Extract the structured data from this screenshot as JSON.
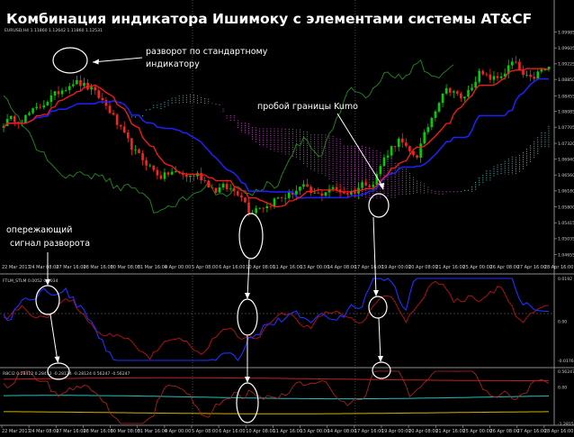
{
  "title": "Комбинация индикатора Ишимоку с элементами системы AT&CF",
  "symbol_label": "EURUSD,H4  1.11860 1.12642 1.11860 1.12531",
  "panel2_label": "FTLM_STLM 0.0052 0.0034",
  "panel3_label": "RBCI2 0.28412 0.28412 -0.28124 -0.28124 0.56247 -0.56247",
  "annotations": {
    "reversal_standard": [
      "разворот по стандартному",
      "индикатору"
    ],
    "kumo_breakout": "пробой границы Kumo",
    "leading_signal": [
      "опережающий",
      "сигнал разворота"
    ]
  },
  "colors": {
    "background": "#000000",
    "bull_candle": "#00d000",
    "bear_candle": "#ff2020",
    "tenkan": "#ff1a1a",
    "kijun": "#2020ff",
    "chikou": "#1e8c1e",
    "kumo_bull": "#4dd0c8",
    "kumo_bear": "#d84cd8",
    "ftlm": "#2030ff",
    "stlm": "#c01010",
    "rbci_cyan": "#20c0c0",
    "rbci_yellow": "#d4b000",
    "rbci_red": "#c02020",
    "grid": "#5a5a5a"
  },
  "chart_data": [
    {
      "type": "candlestick",
      "symbol": "EURUSD",
      "timeframe": "H4",
      "y_ticks": [
        "1.09985",
        "1.09605",
        "1.09225",
        "1.08850",
        "1.08455",
        "1.08085",
        "1.07705",
        "1.07320",
        "1.06940",
        "1.06560",
        "1.06180",
        "1.05800",
        "1.05415",
        "1.05035",
        "1.04655"
      ],
      "ylim": [
        1.0445,
        1.1002
      ],
      "x_ticks": [
        "22 Mar 2017",
        "24 Mar 08:00",
        "27 Mar 16:00",
        "28 Mar 16:00",
        "30 Mar 08:00",
        "31 Mar 16:00",
        "4 Apr 00:00",
        "5 Apr 08:00",
        "6 Apr 16:00",
        "10 Apr 08:00",
        "11 Apr 16:00",
        "13 Apr 00:00",
        "14 Apr 08:00",
        "17 Apr 16:00",
        "19 Apr 00:00",
        "20 Apr 08:00",
        "21 Apr 16:00",
        "25 Apr 00:00",
        "26 Apr 08:00",
        "27 Apr 16:00",
        "28 Apr 16:00"
      ],
      "close_path": [
        1.078,
        1.0792,
        1.0786,
        1.0805,
        1.0818,
        1.0835,
        1.0852,
        1.0866,
        1.088,
        1.0872,
        1.086,
        1.084,
        1.0812,
        1.0775,
        1.0742,
        1.071,
        1.069,
        1.0668,
        1.065,
        1.0664,
        1.066,
        1.0652,
        1.0658,
        1.064,
        1.0618,
        1.0628,
        1.062,
        1.061,
        1.0566,
        1.0582,
        1.058,
        1.06,
        1.0604,
        1.0616,
        1.063,
        1.0612,
        1.0608,
        1.0624,
        1.062,
        1.0612,
        1.0618,
        1.064,
        1.0632,
        1.0686,
        1.072,
        1.074,
        1.0712,
        1.0702,
        1.076,
        1.081,
        1.0858,
        1.0862,
        1.0836,
        1.086,
        1.09,
        1.089,
        1.0886,
        1.0902,
        1.093,
        1.0895,
        1.0884,
        1.0905,
        1.0912
      ]
    },
    {
      "type": "line",
      "indicator": "FTLM_STLM",
      "y_ticks": [
        "0.0192",
        "0.00",
        "-0.0176"
      ],
      "ylim": [
        -0.0176,
        0.0192
      ],
      "series": [
        {
          "name": "FTLM",
          "color": "#2030ff"
        },
        {
          "name": "STLM",
          "color": "#c01010"
        }
      ]
    },
    {
      "type": "line",
      "indicator": "RBCI2",
      "y_ticks": [
        "0.56247",
        "0.00",
        "-1.28158"
      ],
      "ylim": [
        -1.28158,
        0.56247
      ],
      "series": [
        {
          "name": "RBCI",
          "color": "#c02020"
        },
        {
          "name": "upper",
          "color": "#c02020"
        },
        {
          "name": "mid",
          "color": "#20c0c0"
        },
        {
          "name": "lower",
          "color": "#d4b000"
        }
      ]
    }
  ]
}
